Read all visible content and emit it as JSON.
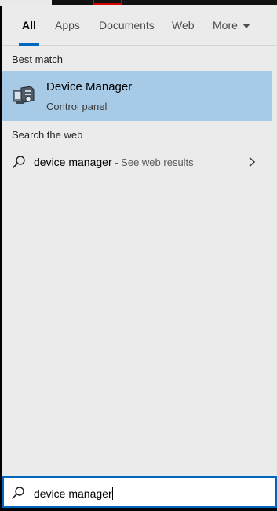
{
  "tabs": [
    {
      "label": "All",
      "active": true
    },
    {
      "label": "Apps",
      "active": false
    },
    {
      "label": "Documents",
      "active": false
    },
    {
      "label": "Web",
      "active": false
    },
    {
      "label": "More",
      "active": false,
      "icon": "caret-down-icon"
    }
  ],
  "best_match": {
    "section_label": "Best match",
    "title": "Device Manager",
    "subtitle": "Control panel",
    "icon": "device-manager-icon"
  },
  "web": {
    "section_label": "Search the web",
    "query": "device manager",
    "hint": " - See web results",
    "icon": "search-icon",
    "chevron_icon": "chevron-right-icon"
  },
  "search": {
    "value": "device manager",
    "icon": "search-icon"
  },
  "colors": {
    "accent": "#0067c0",
    "selected_bg": "#a7cbe7",
    "panel_bg": "#ebebeb"
  }
}
